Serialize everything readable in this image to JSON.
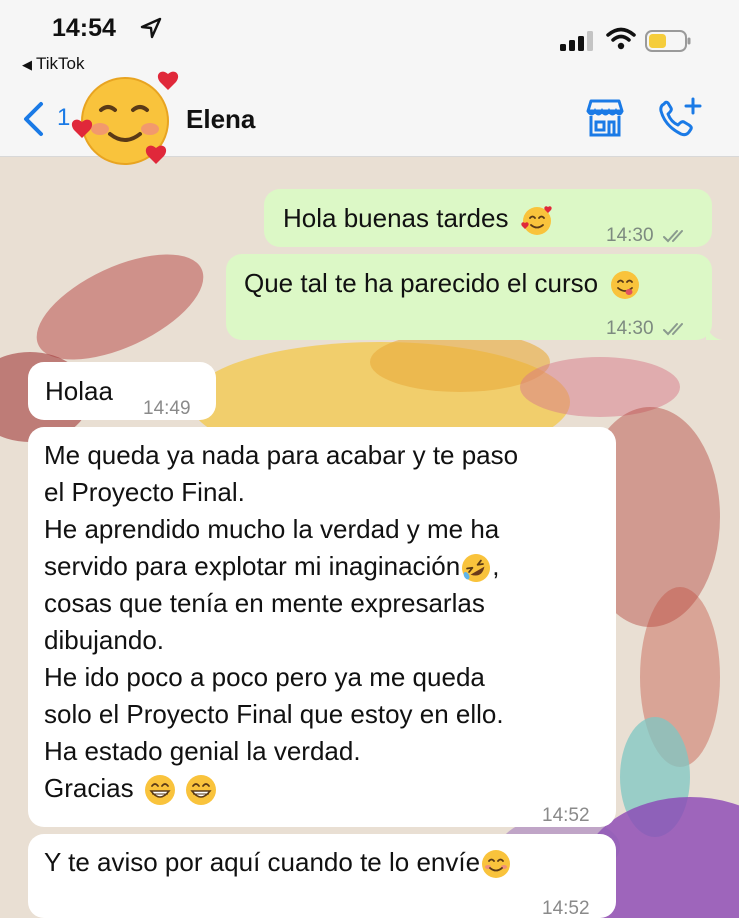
{
  "status_bar": {
    "time": "14:54",
    "back_app": "TikTok"
  },
  "header": {
    "back_count": "1",
    "contact_name": "Elena",
    "avatar_icon": "smiling-face-with-hearts-emoji",
    "accent_color": "#1a7ae6"
  },
  "messages": [
    {
      "direction": "out",
      "text": "Hola buenas tardes",
      "emoji": "smiling-face-with-hearts",
      "time": "14:30",
      "status": "read"
    },
    {
      "direction": "out",
      "text": "Que tal te ha parecido el curso",
      "emoji": "face-savoring-food",
      "time": "14:30",
      "status": "read"
    },
    {
      "direction": "in",
      "text": "Holaa",
      "time": "14:49"
    },
    {
      "direction": "in",
      "lines": [
        "Me queda ya nada para acabar y te paso",
        "el Proyecto Final.",
        "He aprendido mucho la verdad y me ha",
        "servido para explotar mi inaginación",
        "cosas que tenía en mente expresarlas",
        "dibujando.",
        "He ido poco a poco pero ya me queda",
        "solo el Proyecto Final que estoy en ello.",
        "Ha estado genial la verdad.",
        "Gracias"
      ],
      "line4_suffix": ",",
      "time": "14:52"
    },
    {
      "direction": "in",
      "text": "Y te aviso por aquí cuando te lo envíe",
      "emoji": "smiling-face",
      "time": "14:52"
    }
  ]
}
